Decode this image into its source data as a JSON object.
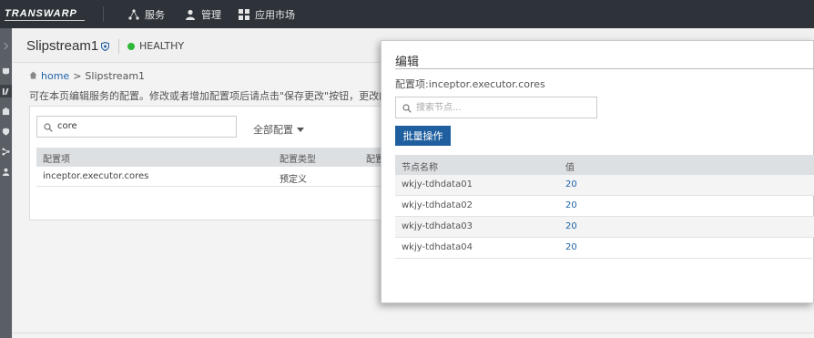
{
  "topbar": {
    "logo": "TRANSWARP",
    "nav": [
      {
        "label": "服务",
        "icon": "services-icon"
      },
      {
        "label": "管理",
        "icon": "user-icon"
      },
      {
        "label": "应用市场",
        "icon": "grid-icon"
      }
    ]
  },
  "service": {
    "title": "Slipstream1",
    "status": "HEALTHY",
    "status_color": "#2eb83a"
  },
  "breadcrumb": {
    "home": "home",
    "sep": ">",
    "current": "Slipstream1"
  },
  "description": "可在本页编辑服务的配置。修改或者增加配置项后请点击\"保存更改\"按钮，更改的配置",
  "config_panel": {
    "search_value": "core",
    "filter_label": "全部配置",
    "columns": [
      "配置项",
      "配置类型",
      "配置"
    ],
    "rows": [
      {
        "name": "inceptor.executor.cores",
        "type": "预定义"
      }
    ]
  },
  "modal": {
    "title": "编辑",
    "subtitle": "配置项:inceptor.executor.cores",
    "search_placeholder": "搜索节点...",
    "batch_button": "批量操作",
    "columns": [
      "节点名称",
      "值"
    ],
    "rows": [
      {
        "node": "wkjy-tdhdata01",
        "value": "20"
      },
      {
        "node": "wkjy-tdhdata02",
        "value": "20"
      },
      {
        "node": "wkjy-tdhdata03",
        "value": "20"
      },
      {
        "node": "wkjy-tdhdata04",
        "value": "20"
      }
    ]
  },
  "colors": {
    "accent": "#1f5f9f",
    "link": "#1f63a8",
    "topbar": "#2e3339"
  }
}
